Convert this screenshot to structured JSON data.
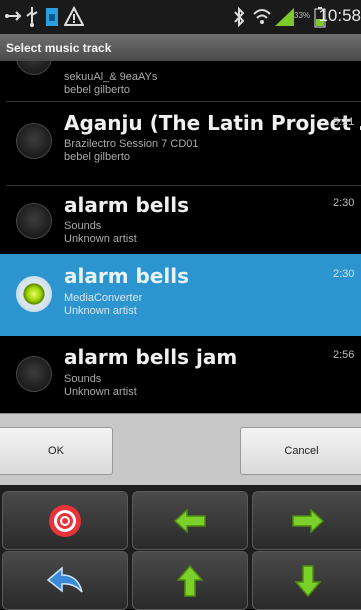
{
  "status_bar": {
    "time": "10:58",
    "battery_percent": "33%",
    "icons": [
      "usb-icon",
      "usb-debug-icon",
      "sim-icon",
      "warning-icon",
      "bluetooth-icon",
      "wifi-icon",
      "signal-icon",
      "battery-icon"
    ]
  },
  "dialog": {
    "title": "Select music track",
    "tracks": [
      {
        "title": "",
        "album": "sekuuAl_& 9eaAYs",
        "artist": "bebel gilberto",
        "duration": "",
        "selected": false
      },
      {
        "title": "Aganju (The Latin Project ...",
        "album": "Brazilectro Session 7 CD01",
        "artist": "bebel gilberto",
        "duration": "5:21",
        "selected": false
      },
      {
        "title": "alarm bells",
        "album": "Sounds",
        "artist": "Unknown artist",
        "duration": "2:30",
        "selected": false
      },
      {
        "title": "alarm bells",
        "album": "MediaConverter",
        "artist": "Unknown artist",
        "duration": "2:30",
        "selected": true
      },
      {
        "title": "alarm bells jam",
        "album": "Sounds",
        "artist": "Unknown artist",
        "duration": "2:56",
        "selected": false
      }
    ],
    "ok_label": "OK",
    "cancel_label": "Cancel"
  },
  "keypad": {
    "keys": [
      "target-icon",
      "arrow-left-icon",
      "arrow-right-icon",
      "back-arrow-icon",
      "arrow-up-icon",
      "arrow-down-icon"
    ],
    "colors": {
      "target": "#e8343a",
      "arrows": "#7bd12a",
      "back": "#3a8ad8"
    }
  },
  "colors": {
    "selected_row": "#2c95cf",
    "title_bar": "#5a5a5a",
    "dialog_buttons_bg": "#c8c8c8"
  }
}
